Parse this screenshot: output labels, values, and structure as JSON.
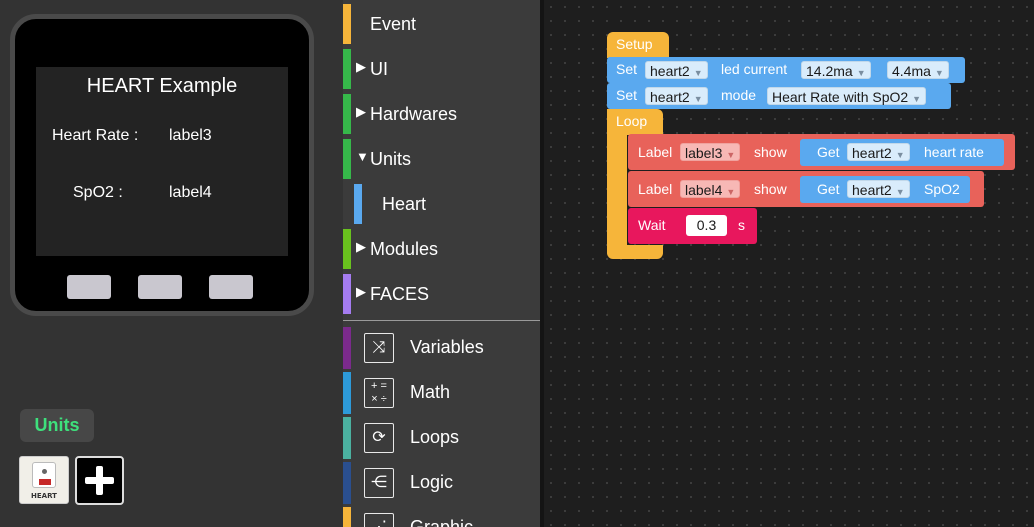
{
  "device": {
    "screen_title": "HEART Example",
    "heart_rate_label": "Heart Rate :",
    "heart_rate_value": "label3",
    "spo2_label": "SpO2 :",
    "spo2_value": "label4"
  },
  "units_panel": {
    "title": "Units",
    "unit_thumb_label": "HEART"
  },
  "toolbox": {
    "categories": [
      {
        "label": "Event",
        "color": "#f6b53a",
        "expanded": null
      },
      {
        "label": "UI",
        "color": "#36b84a",
        "expanded": false
      },
      {
        "label": "Hardwares",
        "color": "#36b84a",
        "expanded": false
      },
      {
        "label": "Units",
        "color": "#36b84a",
        "expanded": true
      },
      {
        "label": "Heart",
        "color": "#5aa9ef",
        "expanded": null
      },
      {
        "label": "Modules",
        "color": "#69c21e",
        "expanded": false
      },
      {
        "label": "FACES",
        "color": "#a57cf0",
        "expanded": false
      }
    ],
    "builtins": [
      {
        "label": "Variables",
        "color": "#7b2a8c",
        "icon": "shuffle-icon"
      },
      {
        "label": "Math",
        "color": "#2d9ad9",
        "icon": "math-icon"
      },
      {
        "label": "Loops",
        "color": "#4bb1a0",
        "icon": "loop-icon"
      },
      {
        "label": "Logic",
        "color": "#2a4f8f",
        "icon": "logic-icon"
      },
      {
        "label": "Graphic",
        "color": "#f6b53a",
        "icon": "graphic-icon"
      }
    ]
  },
  "workspace": {
    "setup_label": "Setup",
    "loop_label": "Loop",
    "set1": {
      "kw": "Set",
      "target": "heart2",
      "mid": "led current",
      "val1": "14.2ma",
      "val2": "4.4ma"
    },
    "set2": {
      "kw": "Set",
      "target": "heart2",
      "mid": "mode",
      "val": "Heart Rate with SpO2"
    },
    "label1": {
      "kw": "Label",
      "target": "label3",
      "show": "show",
      "get": "Get",
      "src": "heart2",
      "prop": "heart rate"
    },
    "label2": {
      "kw": "Label",
      "target": "label4",
      "show": "show",
      "get": "Get",
      "src": "heart2",
      "prop": "SpO2"
    },
    "wait": {
      "kw": "Wait",
      "value": "0.3",
      "unit": "s"
    }
  },
  "colors": {
    "event_yellow": "#f6b53a",
    "hardware_blue": "#5aa9ef",
    "label_red": "#e8625a",
    "wait_pink": "#e8175d"
  }
}
